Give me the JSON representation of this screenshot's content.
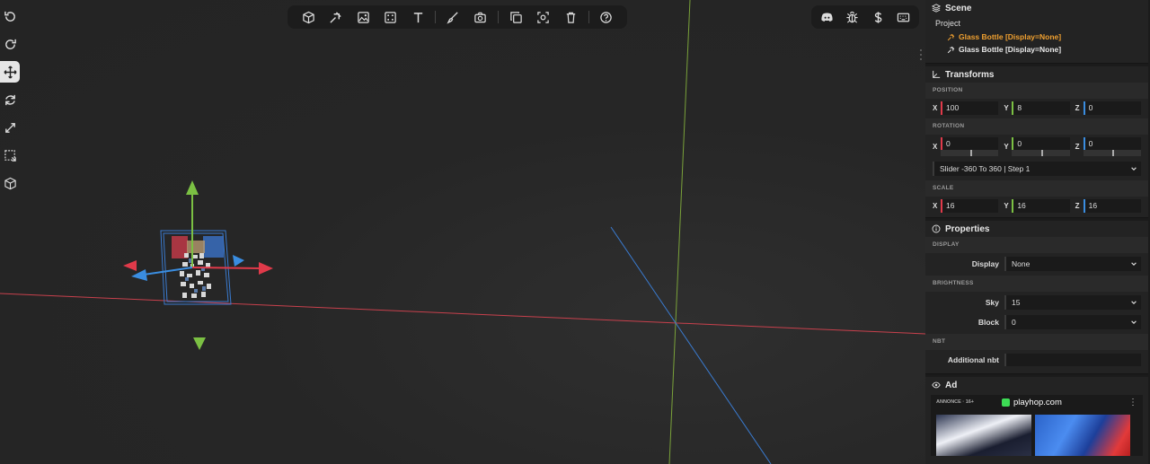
{
  "toolbar": {
    "left_tools": [
      {
        "id": "undo",
        "icon": "undo-icon"
      },
      {
        "id": "redo",
        "icon": "redo-icon"
      },
      {
        "id": "move",
        "icon": "move-icon",
        "active": true
      },
      {
        "id": "rotate",
        "icon": "rotate-icon"
      },
      {
        "id": "scale",
        "icon": "scale-icon"
      },
      {
        "id": "select",
        "icon": "select-box-icon"
      },
      {
        "id": "bounds",
        "icon": "cube-outline-icon"
      }
    ],
    "top_tools": [
      "cube-icon",
      "item-icon",
      "image-icon",
      "frame-icon",
      "text-icon",
      "brush-icon",
      "camera-icon",
      "duplicate-icon",
      "focus-icon",
      "trash-icon",
      "help-icon"
    ],
    "top_right_tools": [
      "discord-icon",
      "bug-icon",
      "dollar-icon",
      "keyboard-icon"
    ]
  },
  "scene": {
    "title": "Scene",
    "root": "Project",
    "items": [
      {
        "label": "Glass Bottle [Display=None]",
        "color": "#f0a030"
      },
      {
        "label": "Glass Bottle [Display=None]",
        "color": "#e8e8e8"
      }
    ]
  },
  "transforms": {
    "title": "Transforms",
    "position_label": "POSITION",
    "position": {
      "x": "100",
      "y": "8",
      "z": "0"
    },
    "rotation_label": "ROTATION",
    "rotation": {
      "x": "0",
      "y": "0",
      "z": "0"
    },
    "slider_mode": "Slider -360 To 360 | Step 1",
    "scale_label": "SCALE",
    "scale": {
      "x": "16",
      "y": "16",
      "z": "16"
    },
    "axis_labels": {
      "x": "X",
      "y": "Y",
      "z": "Z"
    }
  },
  "properties": {
    "title": "Properties",
    "display_label": "DISPLAY",
    "display_field": "Display",
    "display_value": "None",
    "brightness_label": "BRIGHTNESS",
    "sky_field": "Sky",
    "sky_value": "15",
    "block_field": "Block",
    "block_value": "0",
    "nbt_label": "NBT",
    "nbt_field": "Additional nbt",
    "nbt_value": ""
  },
  "ad": {
    "title": "Ad",
    "tag": "ANNONCE · 16+",
    "brand": "playhop.com",
    "menu": "⋮"
  },
  "colors": {
    "axis_x": "#e03a4a",
    "axis_y": "#7bc043",
    "axis_z": "#3a8de0",
    "highlight": "#f0a030"
  }
}
